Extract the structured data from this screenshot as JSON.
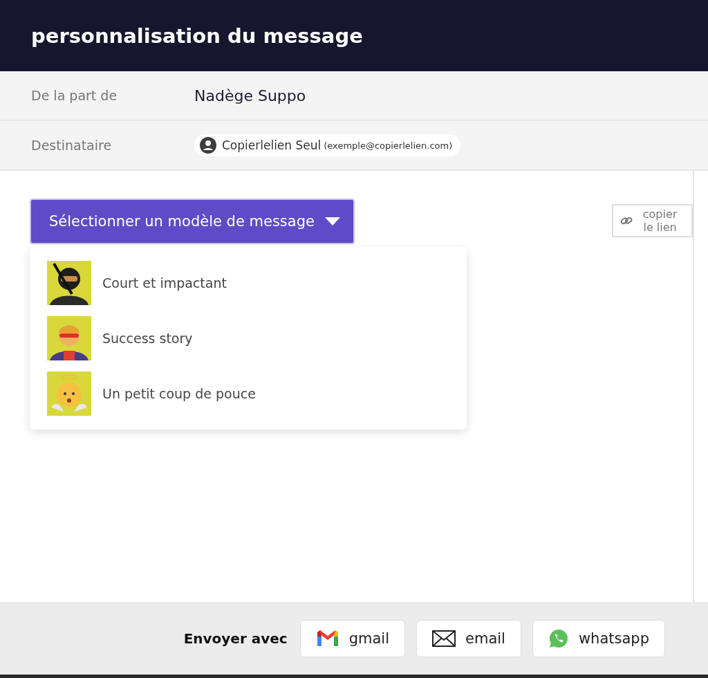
{
  "header": {
    "title": "personnalisation du message"
  },
  "fields": [
    {
      "kind": "text",
      "label": "De la part de",
      "value": "Nadège Suppo"
    },
    {
      "kind": "chip",
      "label": "Destinataire",
      "name": "Copierlelien Seul",
      "email": "(exemple@copierlelien.com)"
    }
  ],
  "template_button": {
    "label": "Sélectionner un modèle de message",
    "expanded": true
  },
  "copy_link": {
    "label": "copier le lien"
  },
  "templates": [
    {
      "kind": "ninja",
      "label": "Court et impactant"
    },
    {
      "kind": "hero",
      "label": "Success story"
    },
    {
      "kind": "angel",
      "label": "Un petit coup de pouce"
    }
  ],
  "footer": {
    "label": "Envoyer avec",
    "buttons": [
      {
        "kind": "gmail",
        "label": "gmail"
      },
      {
        "kind": "email",
        "label": "email"
      },
      {
        "kind": "whatsapp",
        "label": "whatsapp"
      }
    ]
  }
}
